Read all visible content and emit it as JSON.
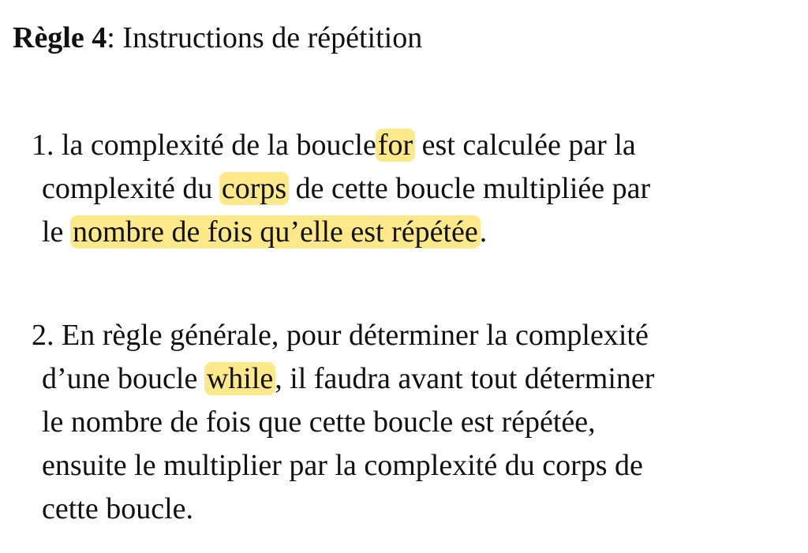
{
  "title": {
    "bold": "Règle 4",
    "rest": ": Instructions de répétition"
  },
  "rules": [
    {
      "number": "1.",
      "line1_a": "la complexité de la boucle",
      "hl_for": "for",
      "line1_b": "est calculée par la",
      "line2_a": "complexité du",
      "hl_corps": "corps",
      "line2_b": "de cette boucle multipliée par",
      "line3_a": "le",
      "hl_nombre": "nombre de fois qu’elle est répétée",
      "line3_b": "."
    },
    {
      "number": "2.",
      "line1": "En règle générale, pour déterminer la complexité",
      "line2_a": "d’une boucle",
      "hl_while": "while",
      "line2_b": ", il faudra avant tout déterminer",
      "line3": "le nombre de fois que cette boucle est répétée,",
      "line4": "ensuite le multiplier par la complexité du corps de",
      "line5": "cette boucle."
    }
  ],
  "colors": {
    "highlight": "#fde98a",
    "text": "#111111",
    "background": "#ffffff"
  }
}
